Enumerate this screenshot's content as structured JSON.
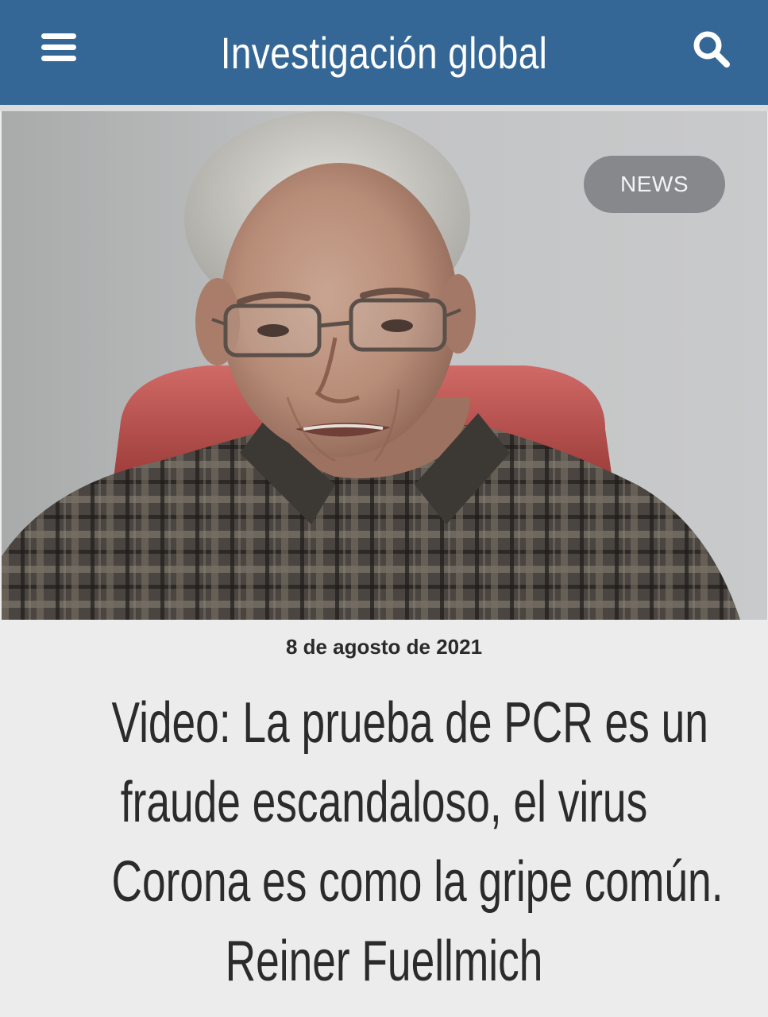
{
  "header": {
    "site_title": "Investigación global",
    "menu_icon": "hamburger-menu-icon",
    "search_icon": "search-icon",
    "background_color": "#356796"
  },
  "article": {
    "category_badge": "NEWS",
    "date": "8 de agosto de 2021",
    "headline": "Video: La prueba de PCR es un fraude escandaloso, el virus Corona es como la gripe común. Reiner Fuellmich",
    "headline_lines": [
      "Video: La prueba de PCR es un",
      "fraude escandaloso, el virus",
      "Corona es como la gripe común.",
      "Reiner Fuellmich"
    ]
  }
}
